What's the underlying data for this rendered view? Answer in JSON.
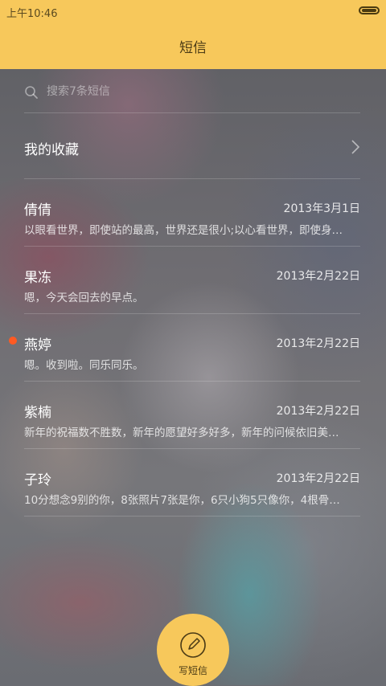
{
  "status_bar": {
    "time": "上午10:46"
  },
  "header": {
    "title": "短信"
  },
  "search": {
    "placeholder": "搜索7条短信",
    "icon": "search-icon"
  },
  "favorites": {
    "label": "我的收藏",
    "icon": "chevron-right-icon"
  },
  "conversations": [
    {
      "name": "倩倩",
      "date": "2013年3月1日",
      "preview": "以眼看世界，即使站的最高，世界还是很小;以心看世界，即使身…",
      "unread": false
    },
    {
      "name": "果冻",
      "date": "2013年2月22日",
      "preview": "嗯，今天会回去的早点。",
      "unread": false
    },
    {
      "name": "燕婷",
      "date": "2013年2月22日",
      "preview": "嗯。收到啦。同乐同乐。",
      "unread": true
    },
    {
      "name": "紫楠",
      "date": "2013年2月22日",
      "preview": "新年的祝福数不胜数，新年的愿望好多好多，新年的问候依旧美…",
      "unread": false
    },
    {
      "name": "子玲",
      "date": "2013年2月22日",
      "preview": "10分想念9别的你，8张照片7张是你，6只小狗5只像你，4根骨…",
      "unread": false
    }
  ],
  "compose": {
    "label": "写短信",
    "icon": "compose-icon"
  },
  "colors": {
    "accent": "#f7c85b",
    "unread_dot": "#ff5a23"
  }
}
